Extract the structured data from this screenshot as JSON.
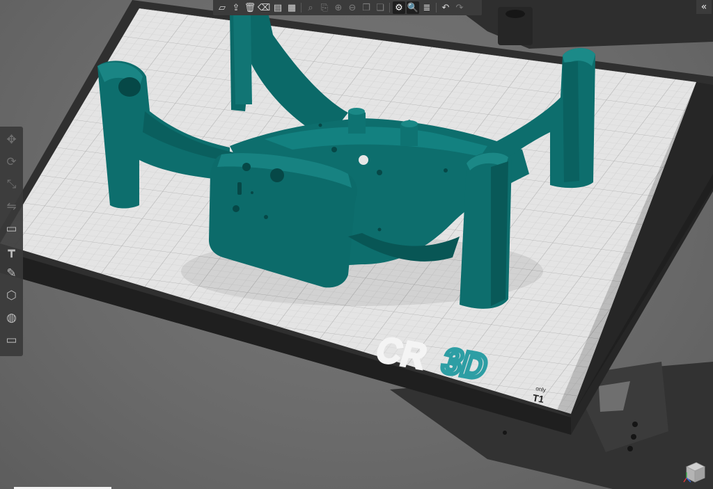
{
  "app": {
    "bed_logo_cr": "CR",
    "bed_logo_3d": "3D",
    "bed_tag_small": "only",
    "bed_tag_large": "T1"
  },
  "top_toolbar": {
    "buttons": [
      {
        "name": "add-model",
        "icon": "add-model-icon",
        "glyph": "▱",
        "enabled": true
      },
      {
        "name": "import",
        "icon": "import-icon",
        "glyph": "⇪",
        "enabled": true
      },
      {
        "name": "delete",
        "icon": "trash-icon",
        "glyph": "🗑",
        "enabled": true
      },
      {
        "name": "erase",
        "icon": "eraser-icon",
        "glyph": "⌫",
        "enabled": true
      },
      {
        "name": "arrange",
        "icon": "arrange-icon",
        "glyph": "▤",
        "enabled": true
      },
      {
        "name": "layout",
        "icon": "layout-icon",
        "glyph": "▦",
        "enabled": true
      },
      {
        "name": "search",
        "icon": "search-icon",
        "glyph": "⌕",
        "enabled": false
      },
      {
        "name": "clone",
        "icon": "clone-icon",
        "glyph": "⎘",
        "enabled": false
      },
      {
        "name": "zoom-in",
        "icon": "plus-circle-icon",
        "glyph": "⊕",
        "enabled": false
      },
      {
        "name": "zoom-out",
        "icon": "minus-circle-icon",
        "glyph": "⊖",
        "enabled": false
      },
      {
        "name": "copy",
        "icon": "copy-icon",
        "glyph": "❐",
        "enabled": false
      },
      {
        "name": "paste",
        "icon": "paste-icon",
        "glyph": "❏",
        "enabled": false
      },
      {
        "name": "settings",
        "icon": "gears-icon",
        "glyph": "⚙",
        "enabled": true,
        "active": true
      },
      {
        "name": "magnify",
        "icon": "magnifier-icon",
        "glyph": "🔍",
        "enabled": true,
        "active": true
      },
      {
        "name": "layers",
        "icon": "layers-icon",
        "glyph": "≣",
        "enabled": true
      },
      {
        "name": "undo",
        "icon": "undo-icon",
        "glyph": "↶",
        "enabled": true
      },
      {
        "name": "redo",
        "icon": "redo-icon",
        "glyph": "↷",
        "enabled": false
      }
    ]
  },
  "left_panel": {
    "tools": [
      {
        "name": "move",
        "icon": "move-icon",
        "glyph": "✥",
        "enabled": false
      },
      {
        "name": "rotate",
        "icon": "rotate-icon",
        "glyph": "⟳",
        "enabled": false
      },
      {
        "name": "scale",
        "icon": "scale-icon",
        "glyph": "⤡",
        "enabled": false
      },
      {
        "name": "mirror",
        "icon": "mirror-icon",
        "glyph": "⇋",
        "enabled": false
      },
      {
        "name": "place-on-face",
        "icon": "place-face-icon",
        "glyph": "▭",
        "enabled": true
      },
      {
        "name": "support",
        "icon": "support-icon",
        "glyph": "┳",
        "enabled": true
      },
      {
        "name": "paint",
        "icon": "paint-brush-icon",
        "glyph": "✎",
        "enabled": true
      },
      {
        "name": "cube",
        "icon": "cube-icon",
        "glyph": "⬡",
        "enabled": true
      },
      {
        "name": "color",
        "icon": "palette-icon",
        "glyph": "◍",
        "enabled": true
      },
      {
        "name": "measure",
        "icon": "ruler-icon",
        "glyph": "▭",
        "enabled": true
      }
    ]
  },
  "colors": {
    "model": "#0d6e6d",
    "model_dark": "#07504f",
    "model_light": "#1b8584",
    "bed_surface": "#e4e4e4",
    "bed_frame": "#3a3a3a",
    "logo_cr": "#f4f4f4",
    "logo_3d": "#2d9ea4"
  }
}
